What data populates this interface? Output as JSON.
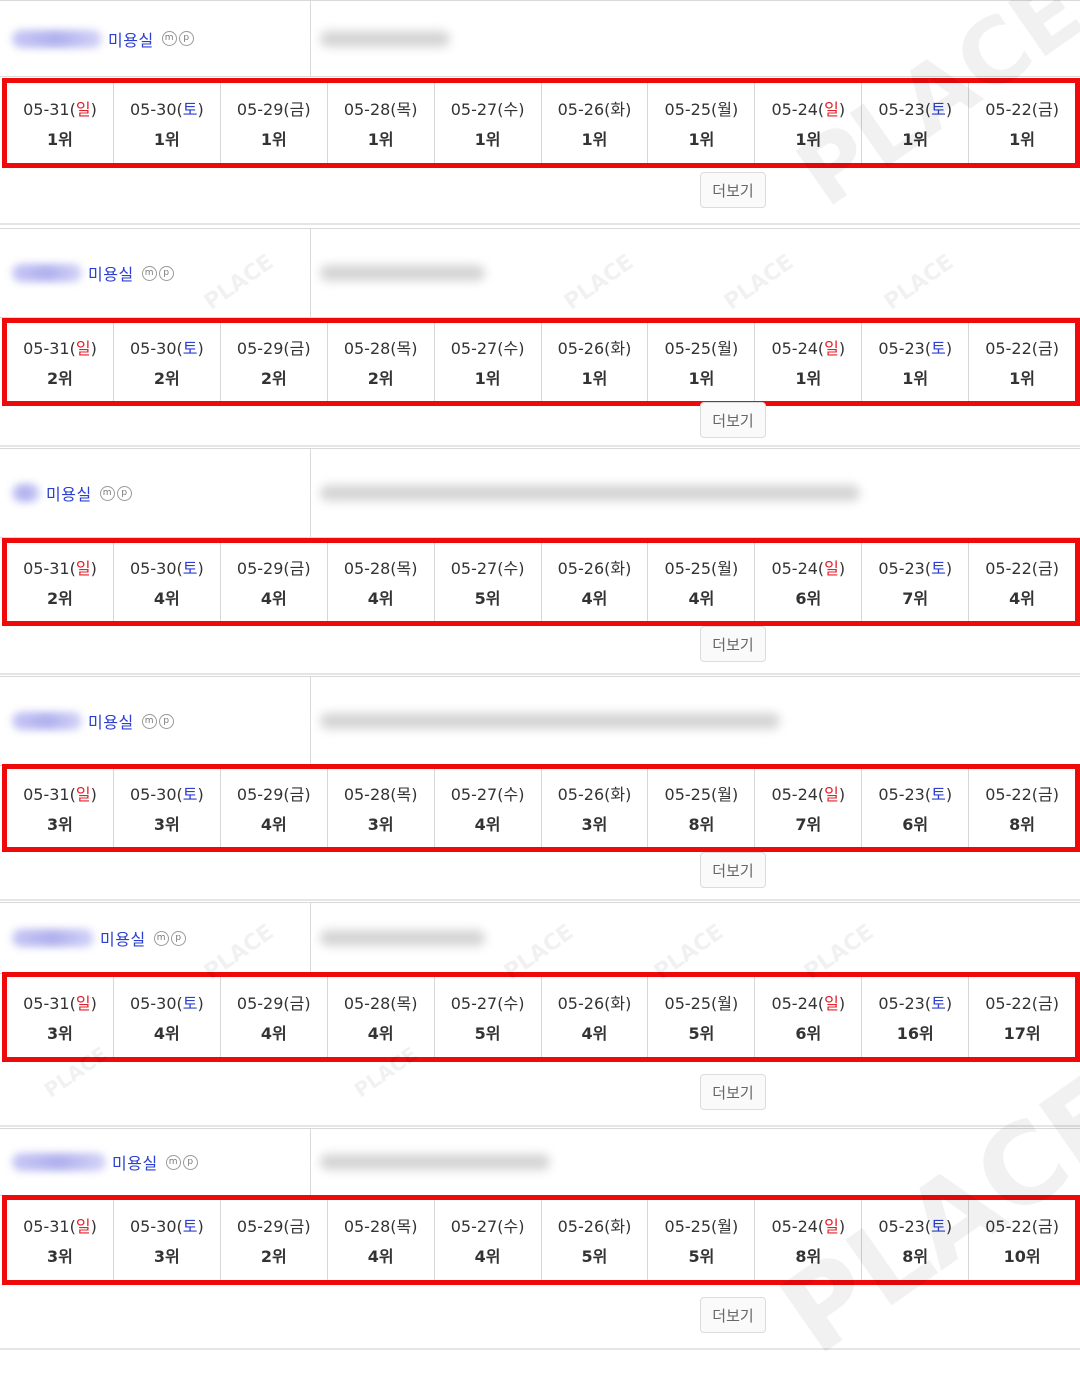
{
  "shop_label": "미용실",
  "badge_m": "m",
  "badge_p": "p",
  "more_label": "더보기",
  "watermark": "PLACE",
  "dates": [
    {
      "date": "05-31",
      "day": "일",
      "type": "sun"
    },
    {
      "date": "05-30",
      "day": "토",
      "type": "sat"
    },
    {
      "date": "05-29",
      "day": "금",
      "type": "weekday"
    },
    {
      "date": "05-28",
      "day": "목",
      "type": "weekday"
    },
    {
      "date": "05-27",
      "day": "수",
      "type": "weekday"
    },
    {
      "date": "05-26",
      "day": "화",
      "type": "weekday"
    },
    {
      "date": "05-25",
      "day": "월",
      "type": "weekday"
    },
    {
      "date": "05-24",
      "day": "일",
      "type": "sun"
    },
    {
      "date": "05-23",
      "day": "토",
      "type": "sat"
    },
    {
      "date": "05-22",
      "day": "금",
      "type": "weekday"
    }
  ],
  "colors": {
    "sunday": "#e4212c",
    "saturday": "#2b3fd1",
    "highlight_border": "#ee0a0a"
  },
  "stores": [
    {
      "ranks": [
        "1위",
        "1위",
        "1위",
        "1위",
        "1위",
        "1위",
        "1위",
        "1위",
        "1위",
        "1위"
      ]
    },
    {
      "ranks": [
        "2위",
        "2위",
        "2위",
        "2위",
        "1위",
        "1위",
        "1위",
        "1위",
        "1위",
        "1위"
      ]
    },
    {
      "ranks": [
        "2위",
        "4위",
        "4위",
        "4위",
        "5위",
        "4위",
        "4위",
        "6위",
        "7위",
        "4위"
      ]
    },
    {
      "ranks": [
        "3위",
        "3위",
        "4위",
        "3위",
        "4위",
        "3위",
        "8위",
        "7위",
        "6위",
        "8위"
      ]
    },
    {
      "ranks": [
        "3위",
        "4위",
        "4위",
        "4위",
        "5위",
        "4위",
        "5위",
        "6위",
        "16위",
        "17위"
      ]
    },
    {
      "ranks": [
        "3위",
        "3위",
        "2위",
        "4위",
        "4위",
        "5위",
        "5위",
        "8위",
        "8위",
        "10위"
      ]
    }
  ]
}
